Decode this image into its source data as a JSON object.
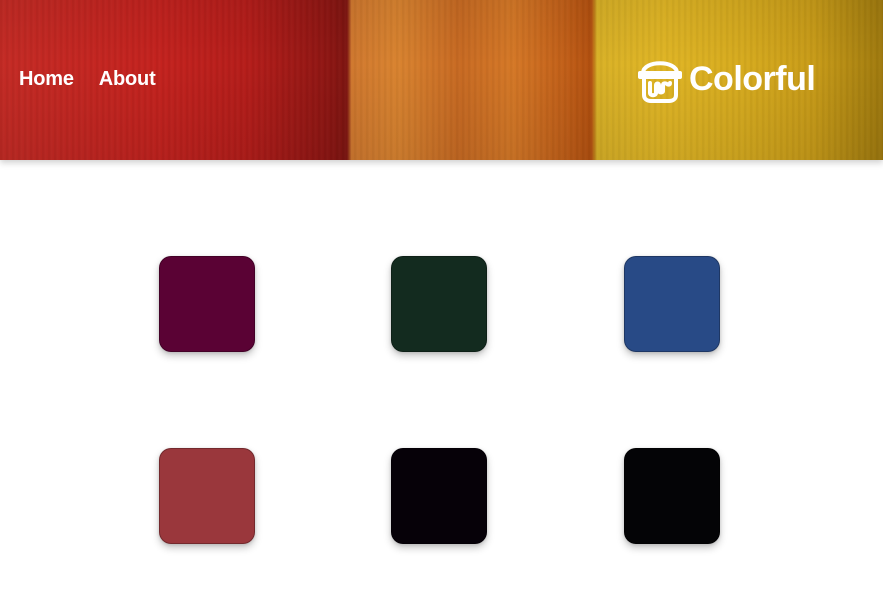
{
  "header": {
    "nav": [
      {
        "label": "Home"
      },
      {
        "label": "About"
      }
    ],
    "brand": {
      "name": "Colorful",
      "icon": "paint-bucket-icon"
    }
  },
  "swatches": [
    {
      "color": "#5a0234"
    },
    {
      "color": "#132b1f"
    },
    {
      "color": "#284a86"
    },
    {
      "color": "#9a373c"
    },
    {
      "color": "#060108"
    },
    {
      "color": "#040406"
    }
  ]
}
